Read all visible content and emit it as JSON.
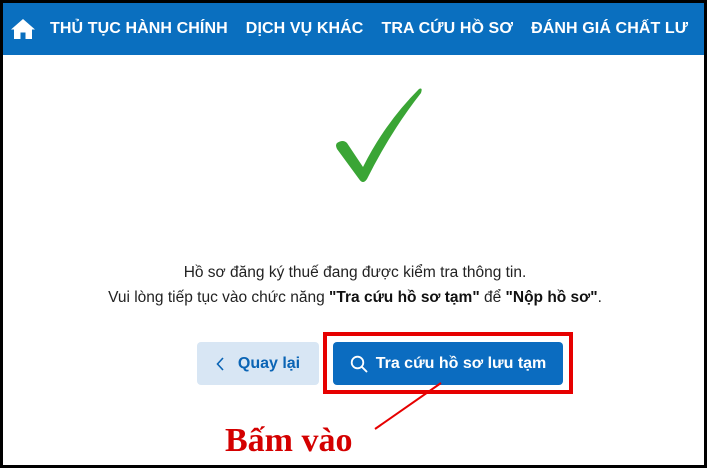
{
  "navbar": {
    "items": [
      {
        "label": "THỦ TỤC HÀNH CHÍNH"
      },
      {
        "label": "DỊCH VỤ KHÁC"
      },
      {
        "label": "TRA CỨU HỒ SƠ"
      },
      {
        "label": "ĐÁNH GIÁ CHẤT LƯ"
      }
    ]
  },
  "message": {
    "line1": "Hồ sơ đăng ký thuế đang được kiểm tra thông tin.",
    "line2_prefix": "Vui lòng tiếp tục vào chức năng ",
    "line2_bold1": "\"Tra cứu hồ sơ tạm\"",
    "line2_mid": " để ",
    "line2_bold2": "\"Nộp hồ sơ\"",
    "line2_suffix": "."
  },
  "buttons": {
    "back_label": "Quay lại",
    "search_label": "Tra cứu hồ sơ lưu tạm"
  },
  "annotation": {
    "text": "Bấm vào"
  },
  "colors": {
    "nav_bg": "#0a6fbf",
    "primary": "#0b6cc0",
    "secondary_bg": "#d8e6f4",
    "check": "#3aa535",
    "highlight": "#e60000"
  },
  "icons": {
    "home": "home-icon",
    "check": "checkmark-icon",
    "back": "chevron-left-icon",
    "search": "search-icon"
  }
}
